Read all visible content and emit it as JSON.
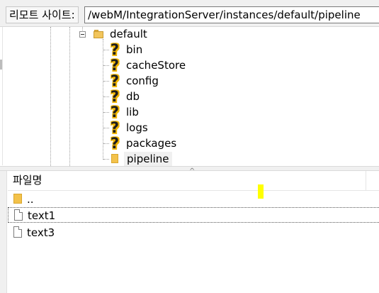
{
  "path_bar": {
    "label": "리모트 사이트:",
    "value": "/webM/IntegrationServer/instances/default/pipeline"
  },
  "tree": {
    "parent": {
      "label": "default",
      "icon": "folder-open-icon",
      "expanded": true
    },
    "children": [
      {
        "label": "bin",
        "icon": "question-folder-icon"
      },
      {
        "label": "cacheStore",
        "icon": "question-folder-icon"
      },
      {
        "label": "config",
        "icon": "question-folder-icon"
      },
      {
        "label": "db",
        "icon": "question-folder-icon"
      },
      {
        "label": "lib",
        "icon": "question-folder-icon"
      },
      {
        "label": "logs",
        "icon": "question-folder-icon"
      },
      {
        "label": "packages",
        "icon": "question-folder-icon"
      },
      {
        "label": "pipeline",
        "icon": "folder-icon",
        "selected": true
      }
    ]
  },
  "file_list": {
    "column_header": "파일명",
    "sort_indicator": "^",
    "rows": [
      {
        "name": "..",
        "icon": "folder-icon"
      },
      {
        "name": "text1",
        "icon": "file-icon",
        "focused": true
      },
      {
        "name": "text3",
        "icon": "file-icon"
      }
    ]
  },
  "colors": {
    "folder": "#f3c24b",
    "question_mark_highlight": "#f0b400",
    "selection_bg": "#f0f0f0",
    "marker": "#ffff00"
  }
}
